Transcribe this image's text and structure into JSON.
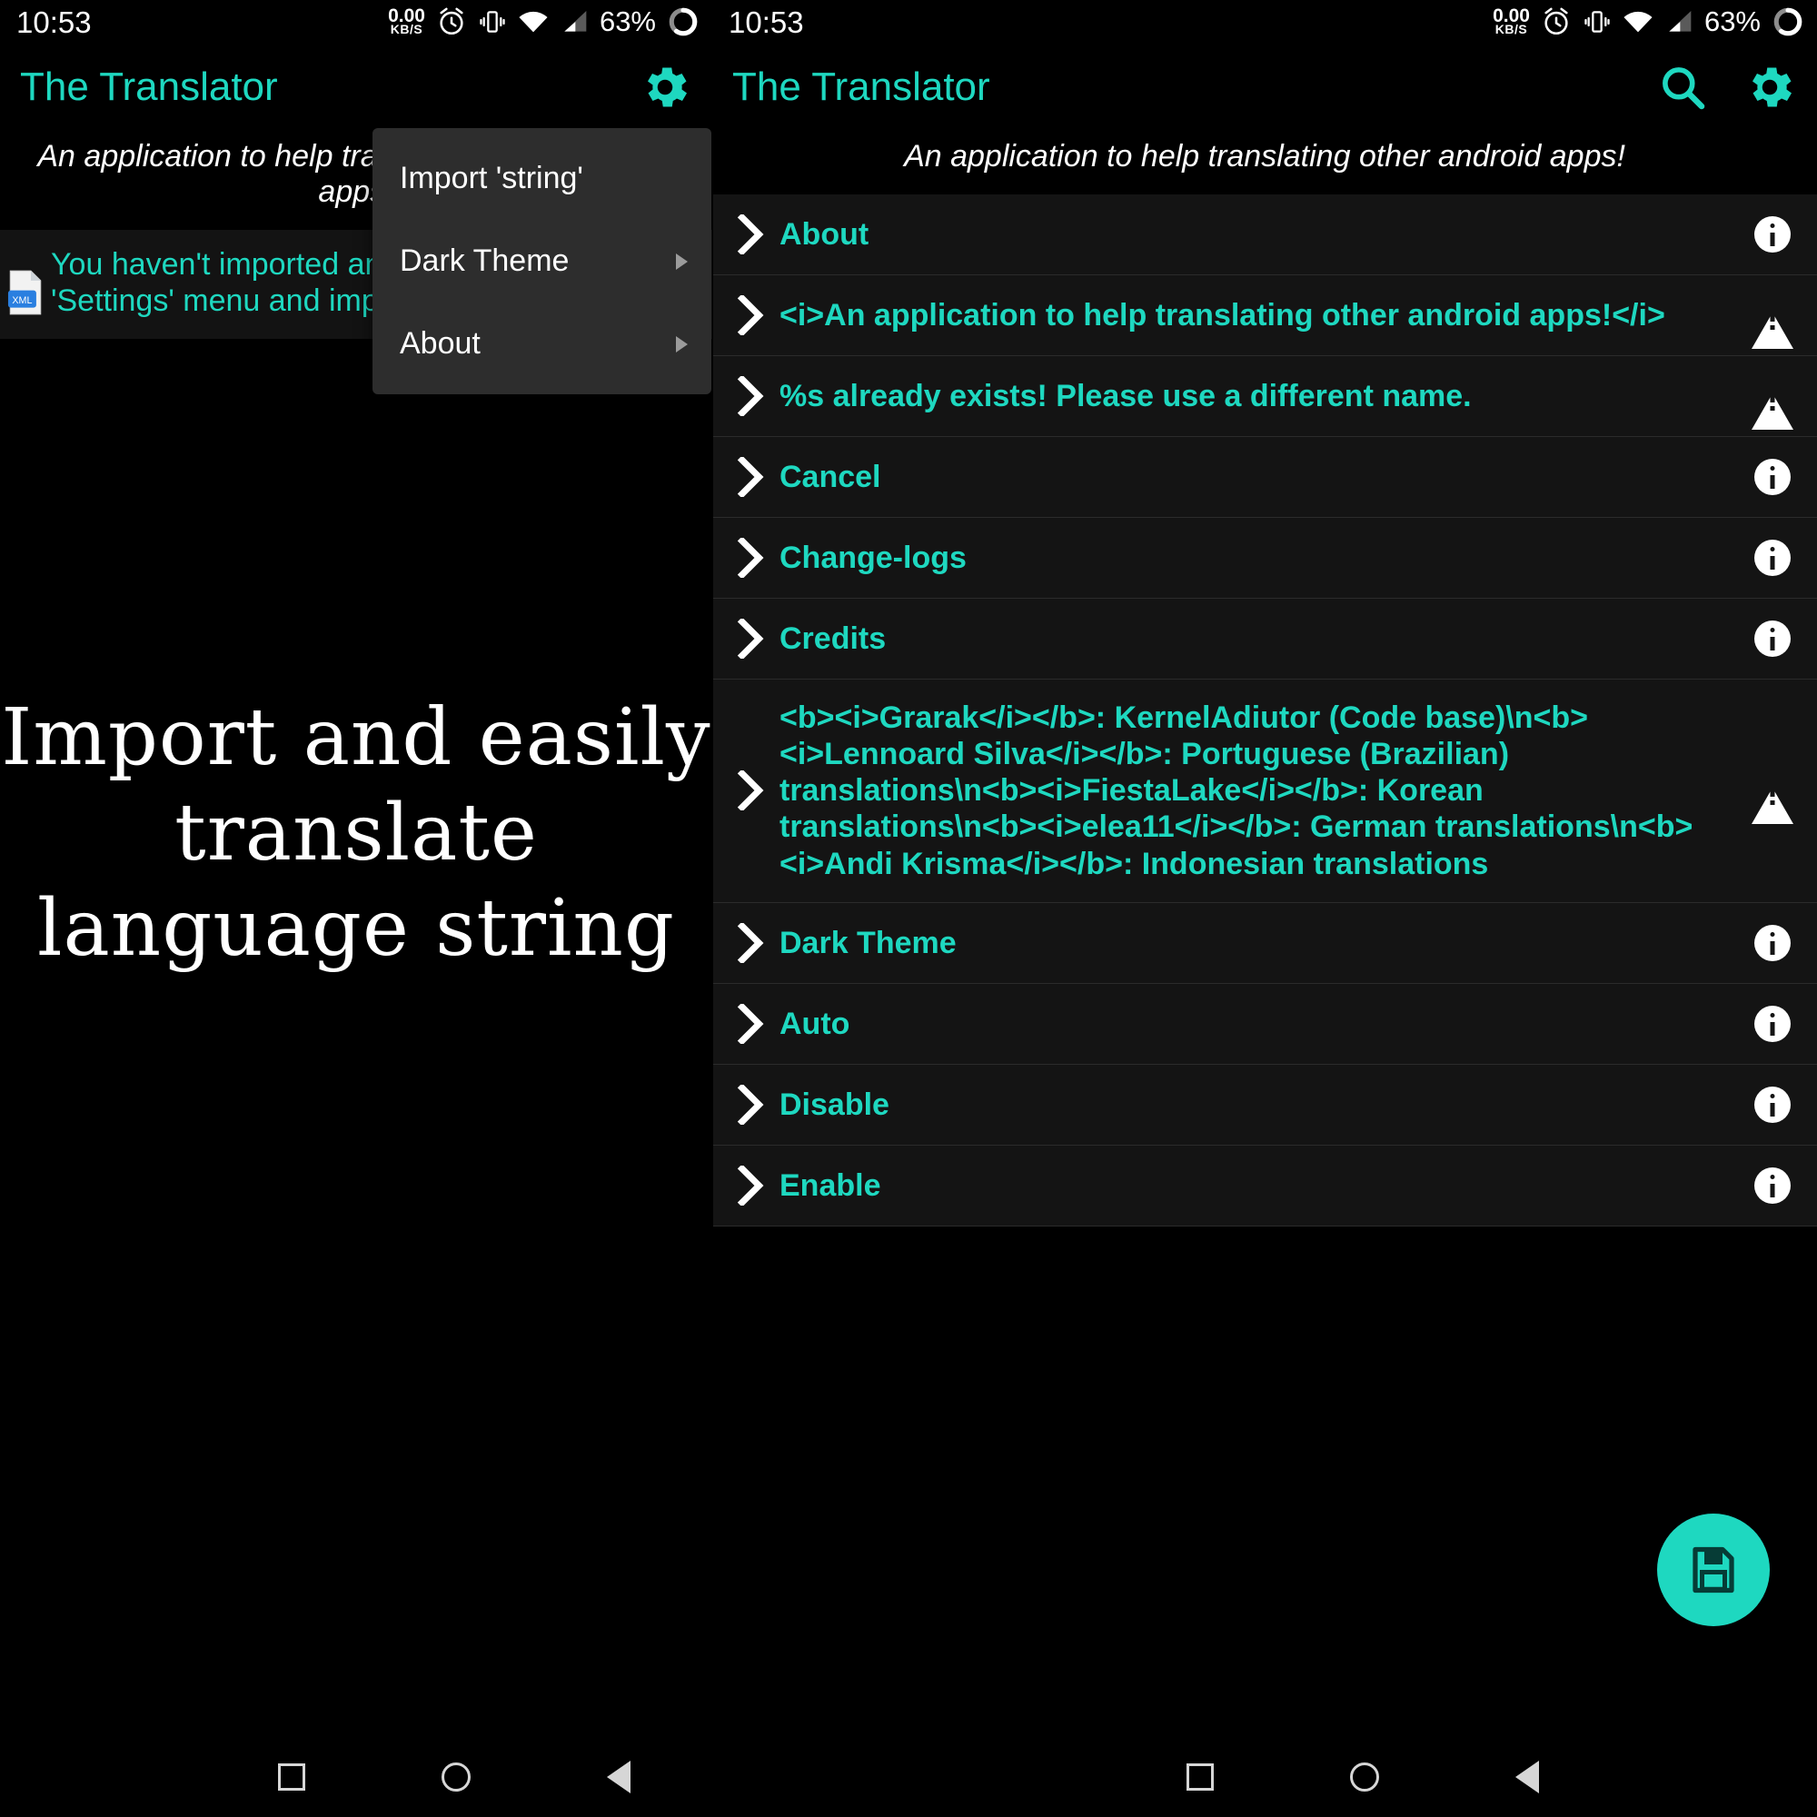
{
  "status_bar": {
    "time": "10:53",
    "net_speed_value": "0.00",
    "net_speed_unit": "KB/S",
    "battery_percent": "63%",
    "icons": [
      "alarm-icon",
      "vibrate-icon",
      "wifi-icon",
      "signal-icon",
      "battery-icon"
    ]
  },
  "app": {
    "title": "The Translator",
    "subtitle": "An application to help translating other android apps!",
    "subtitle_left_visible": "An application to help\nandroid",
    "accent_color": "#1ed8c0",
    "settings_icon": "gear-icon",
    "search_icon": "search-icon"
  },
  "left_panel": {
    "notice": "You haven't imported any 'string' file yet. Go to 'Settings' menu and import from 'sdcard'!",
    "notice_icon": "xml-file-icon",
    "hero_text": "Import and easily translate language string"
  },
  "popup_menu": {
    "items": [
      {
        "label": "Import 'string'",
        "has_submenu": false
      },
      {
        "label": "Dark Theme",
        "has_submenu": true
      },
      {
        "label": "About",
        "has_submenu": true
      }
    ]
  },
  "right_panel": {
    "fab_icon": "save-icon",
    "list": [
      {
        "label": "About",
        "end_icon": "info-icon"
      },
      {
        "label": "<i>An application to help translating other android apps!</i>",
        "end_icon": "warning-icon"
      },
      {
        "label": "%s already exists! Please use a different name.",
        "end_icon": "warning-icon"
      },
      {
        "label": "Cancel",
        "end_icon": "info-icon"
      },
      {
        "label": "Change-logs",
        "end_icon": "info-icon"
      },
      {
        "label": "Credits",
        "end_icon": "info-icon"
      },
      {
        "label": "<b><i>Grarak</i></b>: KernelAdiutor (Code base)\\n<b><i>Lennoard Silva</i></b>: Portuguese (Brazilian) translations\\n<b><i>FiestaLake</i></b>: Korean translations\\n<b><i>elea11</i></b>: German translations\\n<b><i>Andi Krisma</i></b>: Indonesian translations",
        "end_icon": "warning-icon"
      },
      {
        "label": "Dark Theme",
        "end_icon": "info-icon"
      },
      {
        "label": "Auto",
        "end_icon": "info-icon"
      },
      {
        "label": "Disable",
        "end_icon": "info-icon"
      },
      {
        "label": "Enable",
        "end_icon": "info-icon"
      }
    ]
  },
  "nav_bar": {
    "buttons": [
      "recents-square-icon",
      "home-circle-icon",
      "back-triangle-icon"
    ]
  }
}
